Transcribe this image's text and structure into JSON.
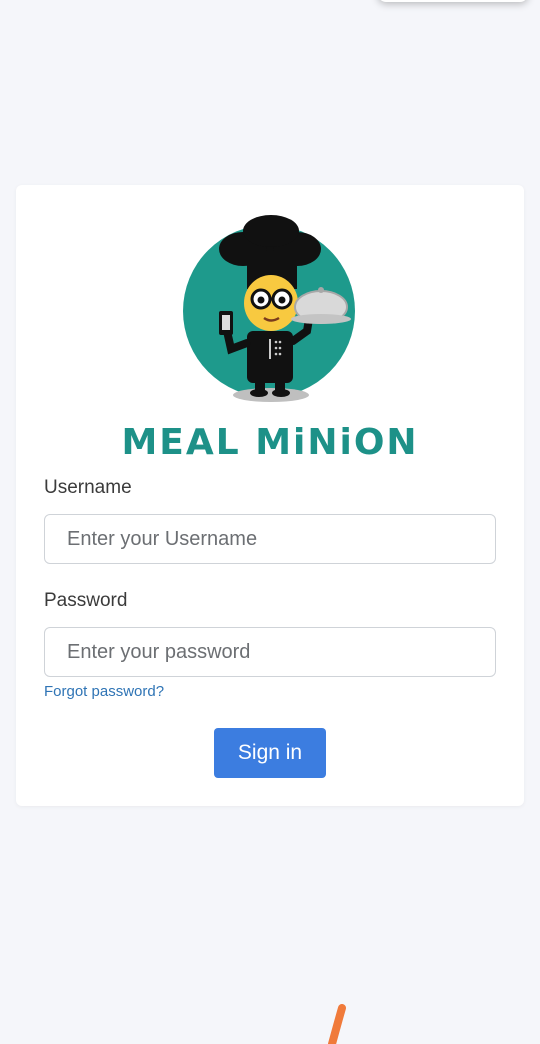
{
  "brand": {
    "name": "MEAL MiNiON",
    "color": "#1d9188"
  },
  "form": {
    "username_label": "Username",
    "username_placeholder": "Enter your Username",
    "username_value": "",
    "password_label": "Password",
    "password_placeholder": "Enter your password",
    "password_value": "",
    "forgot_password": "Forgot password?",
    "submit_label": "Sign in"
  },
  "colors": {
    "background": "#f5f6fa",
    "accent": "#3c7de0",
    "link": "#2f74b5"
  },
  "icons": {
    "logo": "chef-mascot-logo"
  }
}
